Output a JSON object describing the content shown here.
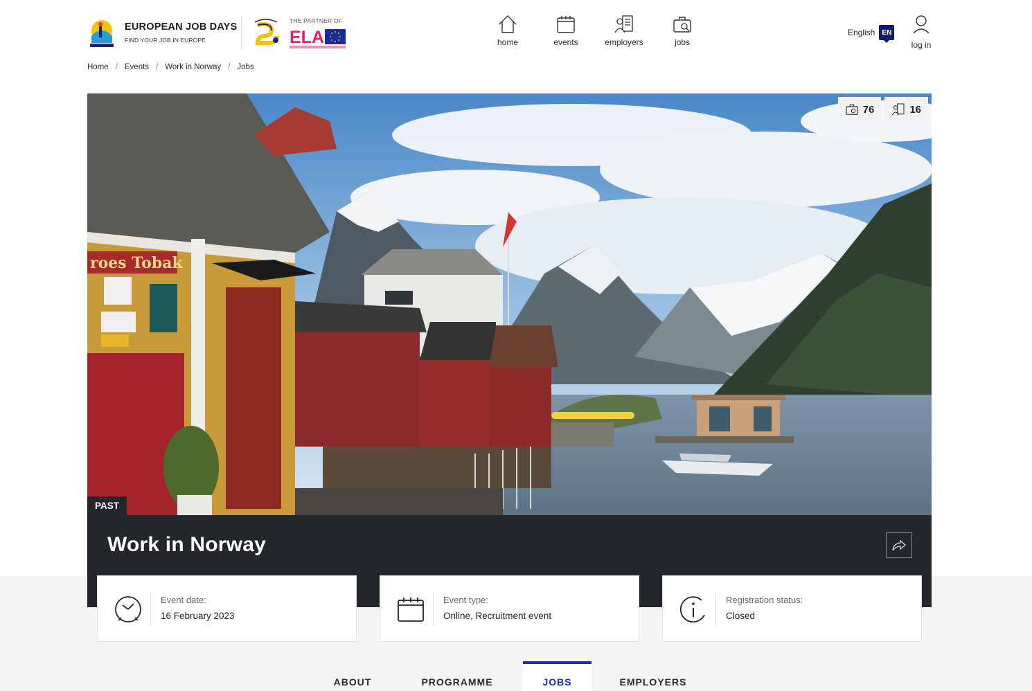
{
  "header": {
    "brand_title": "EUROPEAN JOB DAYS",
    "brand_subtitle": "FIND YOUR JOB IN EUROPE",
    "partner_text": "THE PARTNER OF",
    "nav": [
      {
        "label": "home",
        "icon": "home-icon"
      },
      {
        "label": "events",
        "icon": "calendar-icon"
      },
      {
        "label": "employers",
        "icon": "employers-icon"
      },
      {
        "label": "jobs",
        "icon": "briefcase-icon"
      }
    ],
    "language_label": "English",
    "language_code": "EN",
    "login_label": "log in"
  },
  "breadcrumb": [
    "Home",
    "Events",
    "Work in Norway",
    "Jobs"
  ],
  "hero": {
    "jobs_count": "76",
    "employers_count": "16",
    "status_badge": "PAST"
  },
  "event": {
    "title": "Work in Norway",
    "cards": [
      {
        "label": "Event date:",
        "value": "16 February 2023",
        "icon": "clock-icon"
      },
      {
        "label": "Event type:",
        "value": "Online, Recruitment event",
        "icon": "calendar-icon"
      },
      {
        "label": "Registration status:",
        "value": "Closed",
        "icon": "info-icon"
      }
    ]
  },
  "tabs": [
    {
      "label": "ABOUT",
      "active": false
    },
    {
      "label": "PROGRAMME",
      "active": false
    },
    {
      "label": "JOBS",
      "active": true
    },
    {
      "label": "EMPLOYERS",
      "active": false
    }
  ],
  "colors": {
    "accent": "#1d2bbb",
    "dark_band": "#23272b",
    "lang_badge": "#0d1a6e"
  }
}
